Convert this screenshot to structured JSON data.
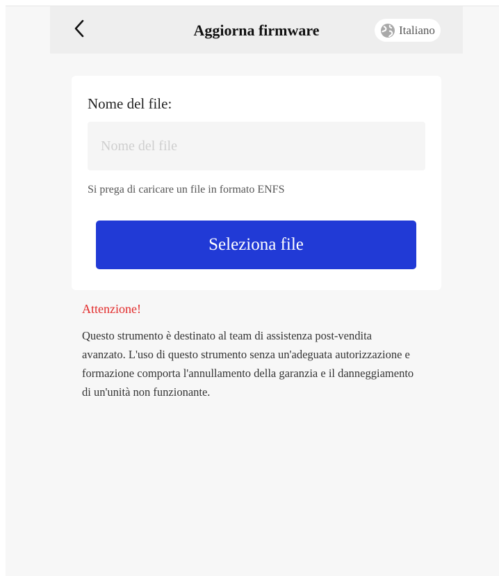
{
  "header": {
    "title": "Aggiorna firmware",
    "back_icon": "chevron-left-icon",
    "language": {
      "icon": "globe-icon",
      "label": "Italiano"
    }
  },
  "upload": {
    "field_label": "Nome del file:",
    "input_value": "",
    "input_placeholder": "Nome del file",
    "hint": "Si prega di caricare un file in formato ENFS",
    "select_button_label": "Seleziona file",
    "button_color": "#213ad6"
  },
  "warning": {
    "title": "Attenzione!",
    "title_color": "#e22a2a",
    "text": "Questo strumento è destinato al team di assistenza post-vendita avanzato. L'uso di questo strumento senza un'adeguata autorizzazione e formazione comporta l'annullamento della garanzia e il danneggiamento di un'unità non funzionante."
  }
}
